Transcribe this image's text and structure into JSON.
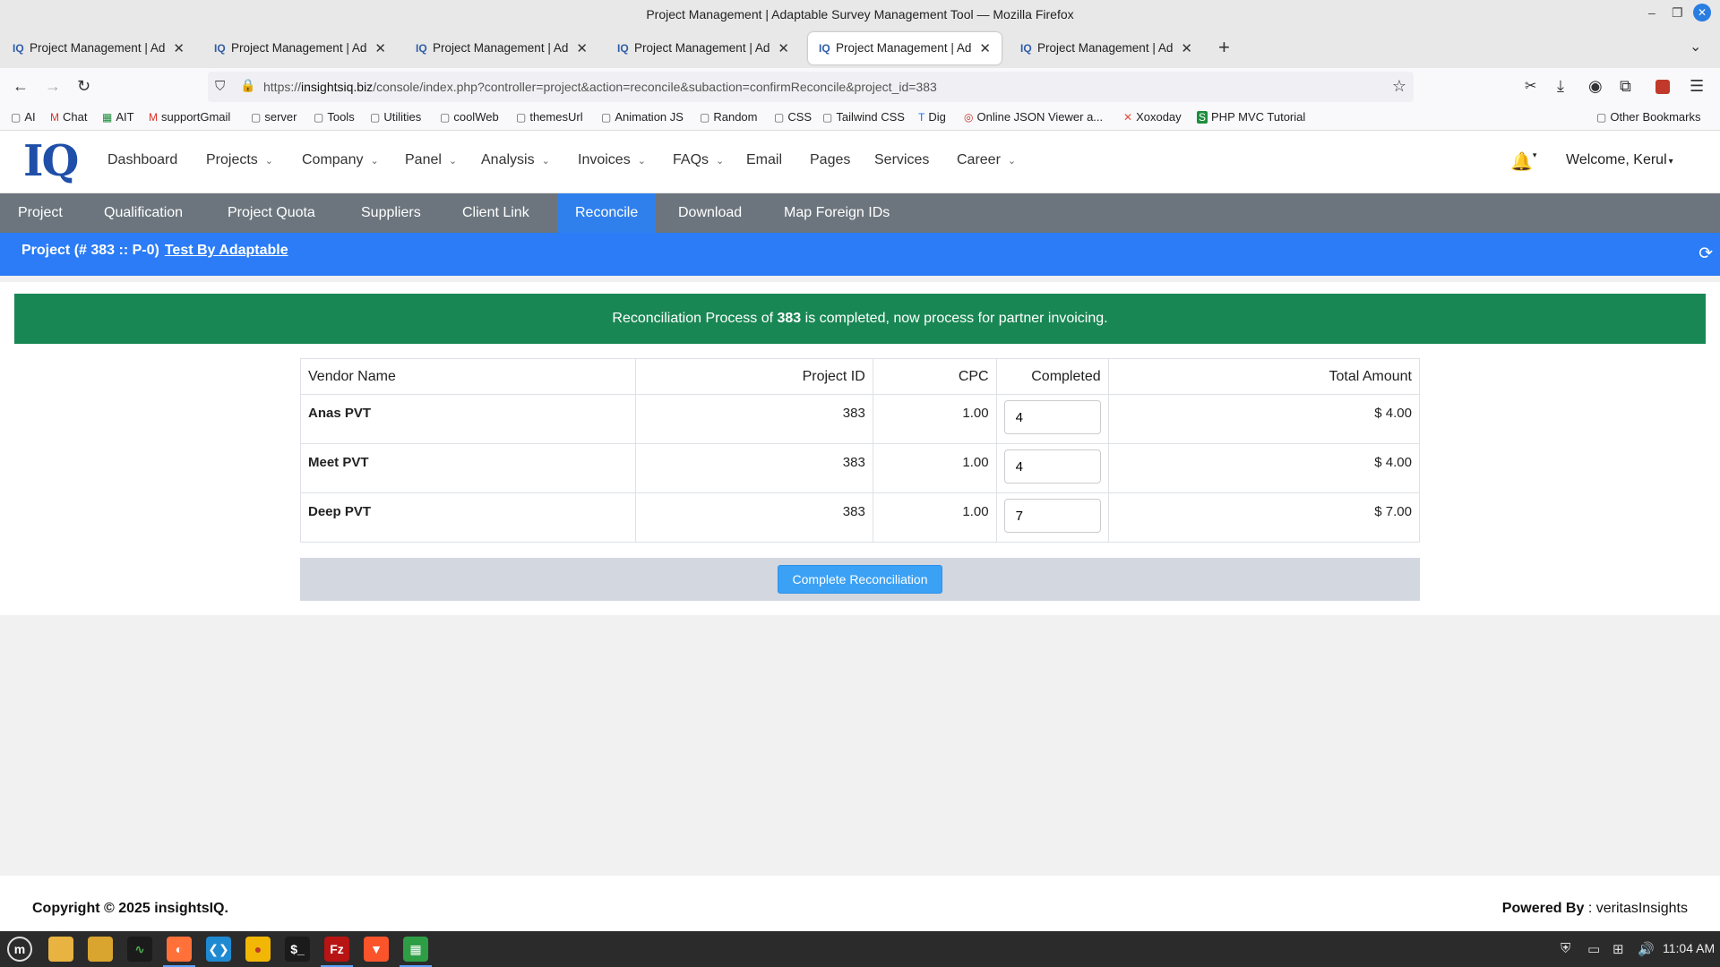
{
  "window": {
    "title": "Project Management | Adaptable Survey Management Tool — Mozilla Firefox",
    "minimize": "–",
    "maximize": "❐",
    "close": "✕"
  },
  "tabs": [
    {
      "label": "Project Management | Adaptable Survey Management Tool",
      "favicon": "IQ",
      "close": "✕"
    },
    {
      "label": "Project Management | Adaptable Survey Management Tool",
      "favicon": "IQ",
      "close": "✕"
    },
    {
      "label": "Project Management | Adaptable Survey Management Tool",
      "favicon": "IQ",
      "close": "✕"
    },
    {
      "label": "Project Management | Adaptable Survey Management Tool",
      "favicon": "IQ",
      "close": "✕"
    },
    {
      "label": "Project Management | Adaptable Survey Management Tool",
      "favicon": "IQ",
      "close": "✕"
    },
    {
      "label": "Project Management | Adaptable Survey Management Tool",
      "favicon": "IQ",
      "close": "✕"
    }
  ],
  "new_tab": "+",
  "tab_list": "⌄",
  "navbar": {
    "back": "←",
    "forward": "→",
    "reload": "↻",
    "url_prefix": "https://",
    "url_host": "insightsiq.biz",
    "url_path": "/console/index.php?controller=project&action=reconcile&subaction=confirmReconcile&project_id=383"
  },
  "bookmarks": [
    {
      "label": "AI"
    },
    {
      "label": "Chat"
    },
    {
      "label": "AIT"
    },
    {
      "label": "supportGmail"
    },
    {
      "label": "server"
    },
    {
      "label": "Tools"
    },
    {
      "label": "Utilities"
    },
    {
      "label": "coolWeb"
    },
    {
      "label": "themesUrl"
    },
    {
      "label": "Animation JS"
    },
    {
      "label": "Random"
    },
    {
      "label": "CSS"
    },
    {
      "label": "Tailwind CSS"
    },
    {
      "label": "Dig"
    },
    {
      "label": "Online JSON Viewer a..."
    },
    {
      "label": "Xoxoday"
    },
    {
      "label": "PHP MVC Tutorial"
    },
    {
      "label": "Other Bookmarks"
    }
  ],
  "app": {
    "logo": "IQ",
    "nav": [
      "Dashboard",
      "Projects",
      "Company",
      "Panel",
      "Analysis",
      "Invoices",
      "FAQs",
      "Email",
      "Pages",
      "Services",
      "Career"
    ],
    "welcome": "Welcome, Kerul"
  },
  "subnav": [
    "Project",
    "Qualification",
    "Project Quota",
    "Suppliers",
    "Client Link",
    "Reconcile",
    "Download",
    "Map Foreign IDs"
  ],
  "project": {
    "prefix": "Project (# 383 :: P-0)",
    "link": "Test By Adaptable"
  },
  "alert": {
    "before": "Reconciliation Process of ",
    "bold": "383",
    "after": " is completed, now process for partner invoicing."
  },
  "table": {
    "headers": [
      "Vendor Name",
      "Project ID",
      "CPC",
      "Completed",
      "Total Amount"
    ],
    "rows": [
      {
        "vendor": "Anas PVT",
        "project_id": "383",
        "cpc": "1.00",
        "completed": "4",
        "total": "$ 4.00"
      },
      {
        "vendor": "Meet PVT",
        "project_id": "383",
        "cpc": "1.00",
        "completed": "4",
        "total": "$ 4.00"
      },
      {
        "vendor": "Deep PVT",
        "project_id": "383",
        "cpc": "1.00",
        "completed": "7",
        "total": "$ 7.00"
      }
    ]
  },
  "button": {
    "complete": "Complete Reconciliation"
  },
  "footer": {
    "copyright": "Copyright © 2025 insightsIQ.",
    "powered_label": "Powered By",
    "powered_value": " : veritasInsights"
  },
  "taskbar": {
    "clock": "11:04 AM"
  }
}
